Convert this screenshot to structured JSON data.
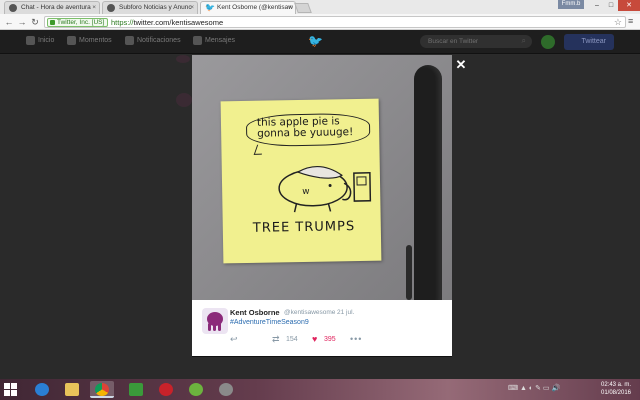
{
  "browser": {
    "tabs": [
      {
        "title": "Chat - Hora de aventura"
      },
      {
        "title": "Subforo Noticias y Anunc"
      },
      {
        "title": "Kent Osborne (@kentisaw"
      }
    ],
    "user_badge": "Fmm.b",
    "address": {
      "ev_label": "Twitter, Inc. [US]",
      "protocol": "https://",
      "host_path": "twitter.com/kentisawesome"
    }
  },
  "twitter_nav": {
    "items": [
      "Inicio",
      "Momentos",
      "Notificaciones",
      "Mensajes"
    ],
    "search_placeholder": "Buscar en Twitter",
    "tweet_button": "Twittear"
  },
  "media": {
    "bubble_text": "this apple pie is gonna be yuuuge!",
    "sign_text": "TREE TRUMPS"
  },
  "tweet": {
    "author_name": "Kent Osborne",
    "handle": "@kentisawesome",
    "date": "· 21 jul.",
    "hashtag": "#AdventureTimeSeason9",
    "retweets": "154",
    "likes": "395"
  },
  "taskbar": {
    "time": "02:43 a. m.",
    "date": "01/08/2016"
  },
  "colors": {
    "twitter_blue": "#1da1f2",
    "like_red": "#e0245e",
    "link_blue": "#2b6cb0"
  }
}
